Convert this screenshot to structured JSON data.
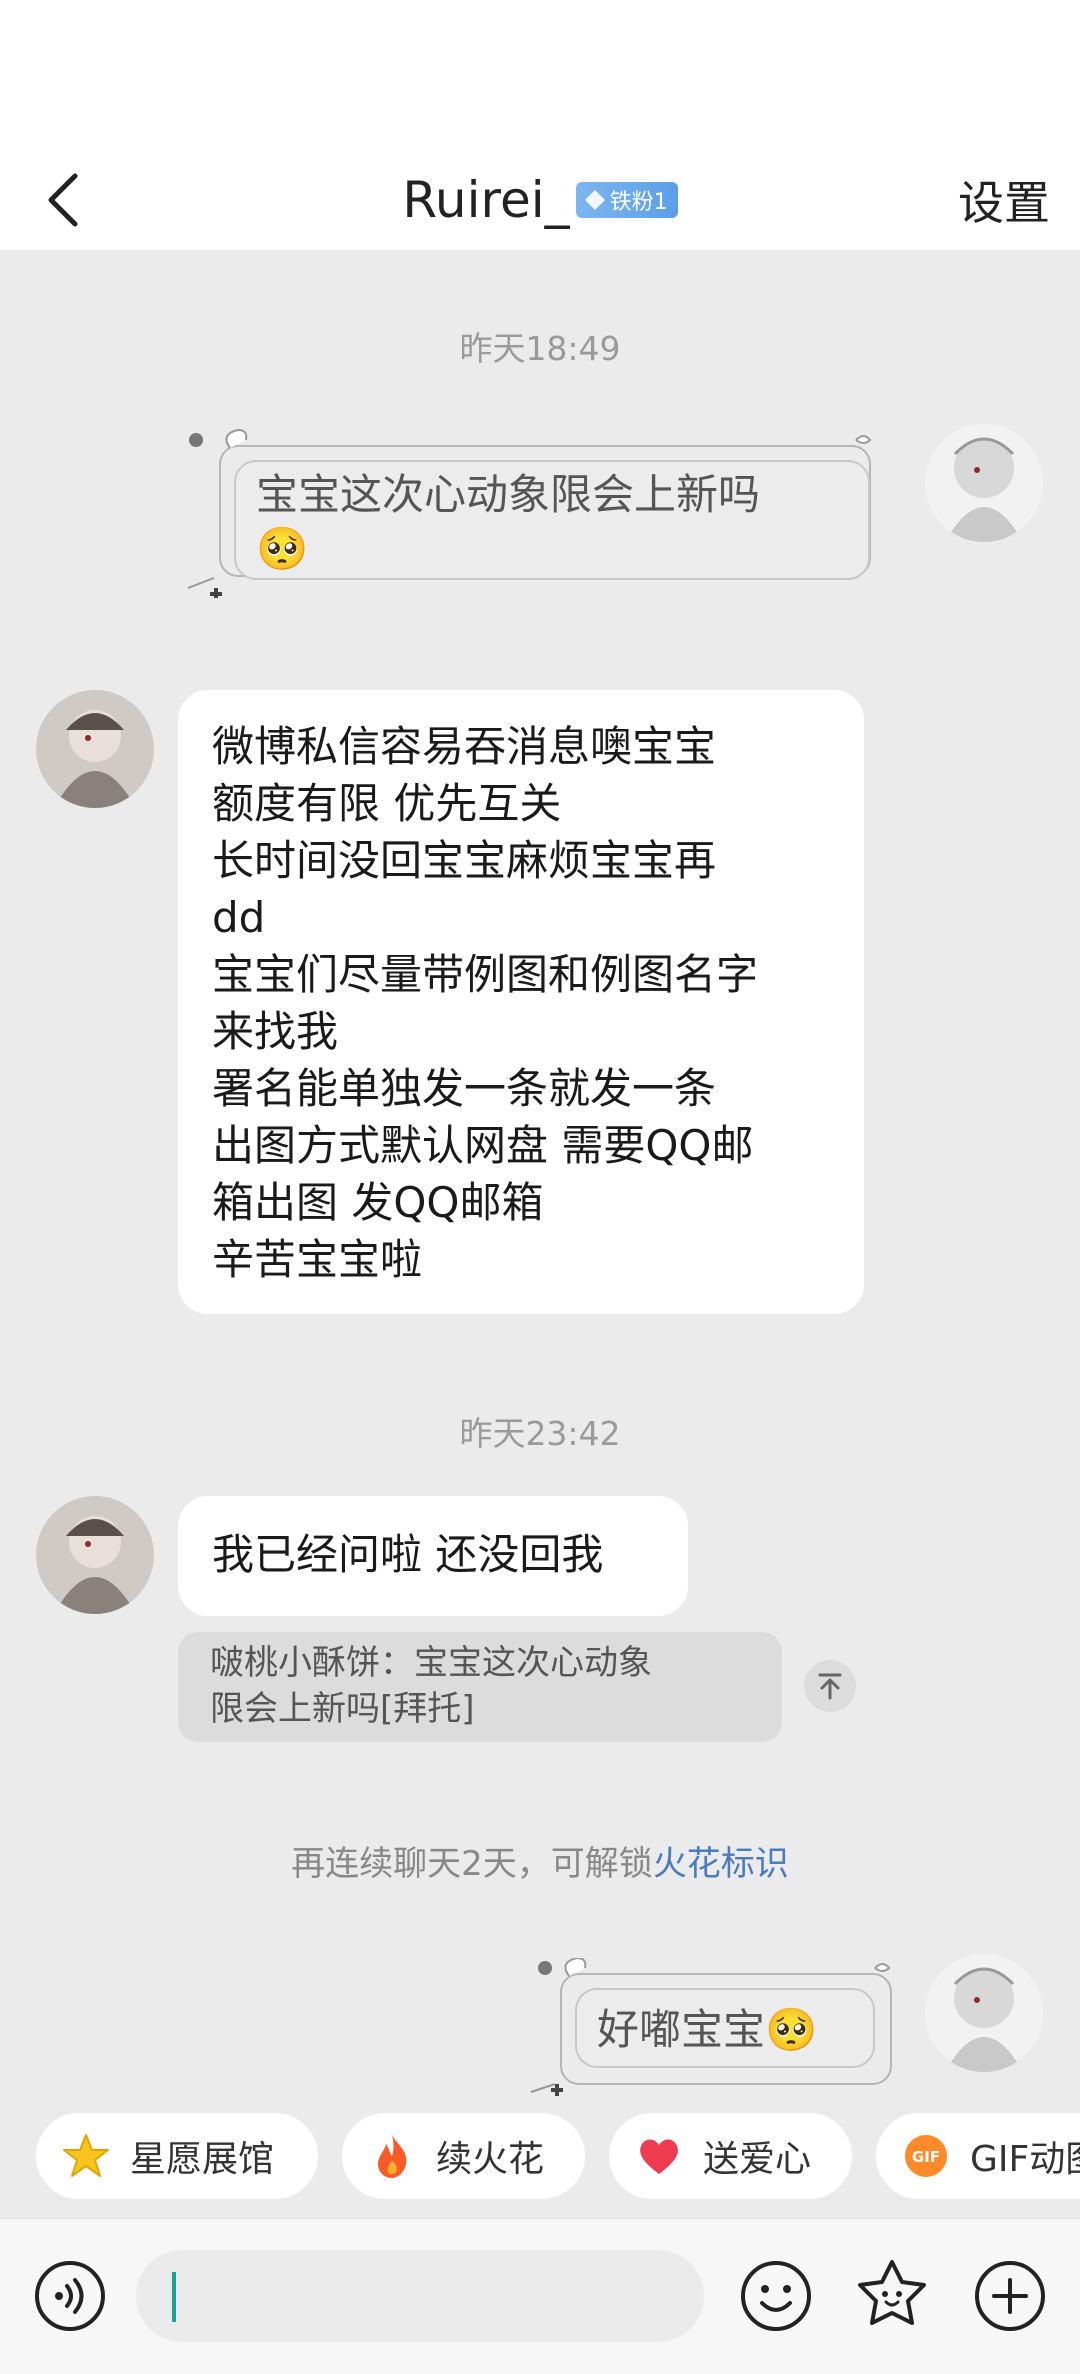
{
  "header": {
    "title": "Ruirei_",
    "badge_label": "铁粉1",
    "settings_label": "设置"
  },
  "messages": {
    "timestamp_1": "昨天18:49",
    "outgoing_1": "宝宝这次心动象限会上新吗",
    "outgoing_1_emoji": "🥺",
    "incoming_1_lines": [
      "微博私信容易吞消息噢宝宝",
      "额度有限 优先互关",
      "长时间没回宝宝麻烦宝宝再",
      "dd",
      "宝宝们尽量带例图和例图名字",
      "来找我",
      "署名能单独发一条就发一条",
      "出图方式默认网盘 需要QQ邮",
      "箱出图 发QQ邮箱",
      "辛苦宝宝啦"
    ],
    "timestamp_2": "昨天23:42",
    "incoming_2": "我已经问啦 还没回我",
    "quote_line_1": "啵桃小酥饼：宝宝这次心动象",
    "quote_line_2": "限会上新吗[拜托]",
    "system_tip_text": "再连续聊天2天，可解锁",
    "system_tip_link": "火花标识",
    "outgoing_2": "好嘟宝宝",
    "outgoing_2_emoji": "🥺"
  },
  "quick_actions": [
    {
      "label": "星愿展馆",
      "icon": "star-icon"
    },
    {
      "label": "续火花",
      "icon": "fire-icon"
    },
    {
      "label": "送爱心",
      "icon": "heart-icon"
    },
    {
      "label": "GIF动图",
      "icon": "gif-icon"
    }
  ],
  "colors": {
    "background": "#ebebeb",
    "link": "#4a7bbf",
    "caret": "#1aa39a",
    "badge": "#5b9ee8"
  }
}
